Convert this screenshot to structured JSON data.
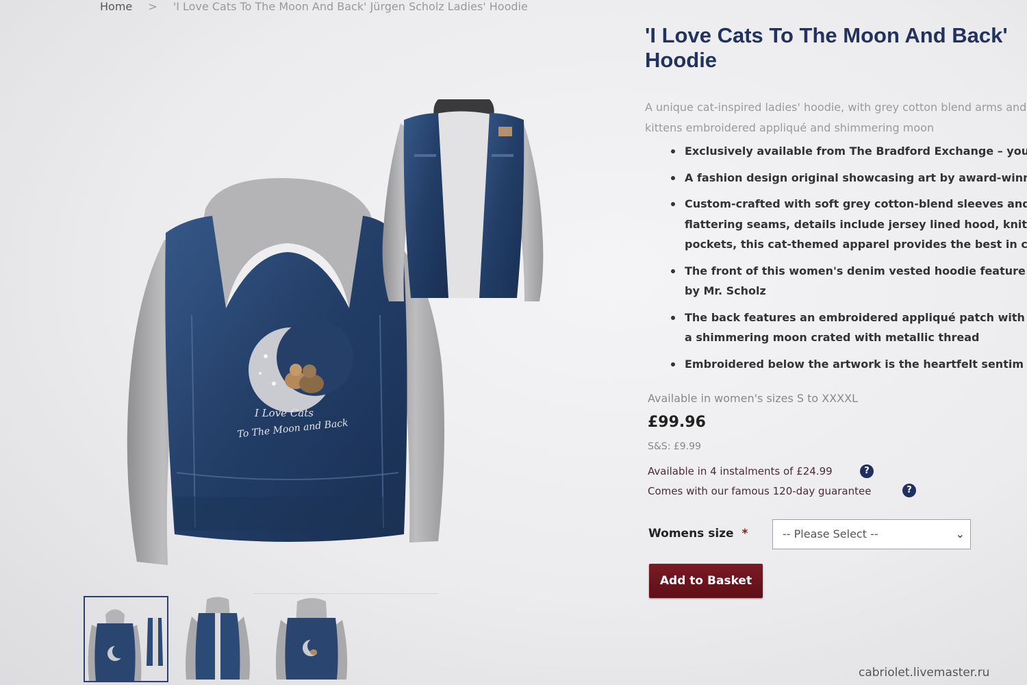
{
  "breadcrumb": {
    "home": "Home",
    "separator": ">",
    "current": "'I Love Cats To The Moon And Back' Jürgen Scholz Ladies' Hoodie"
  },
  "product": {
    "title_line1": "'I Love Cats To The Moon And Back'",
    "title_line2": "Hoodie",
    "description_line1": "A unique cat-inspired ladies' hoodie, with grey cotton blend arms and",
    "description_line2": "kittens embroidered appliqué and shimmering moon",
    "bullets": [
      {
        "lines": [
          "Exclusively available from The Bradford Exchange – you"
        ]
      },
      {
        "lines": [
          "A fashion design original showcasing art by award-winn"
        ]
      },
      {
        "lines": [
          "Custom-crafted with soft grey cotton-blend sleeves and",
          "flattering seams, details include jersey lined hood, knit",
          "pockets, this cat-themed apparel provides the best in co"
        ]
      },
      {
        "lines": [
          "The front of this women's denim vested hoodie feature",
          "by Mr. Scholz"
        ]
      },
      {
        "lines": [
          "The back features an embroidered appliqué patch with",
          "a shimmering moon crated with metallic thread"
        ]
      },
      {
        "lines": [
          "Embroidered below the artwork is the heartfelt sentim"
        ]
      }
    ],
    "embroidery_line1": "I Love Cats",
    "embroidery_line2": "To The Moon and Back",
    "sizes_note": "Available in women's sizes S to XXXXL",
    "price": "£99.96",
    "shipping": "S&S: £9.99",
    "instalments": "Available in 4 instalments of £24.99",
    "guarantee": "Comes with our famous 120-day guarantee",
    "help_glyph": "?"
  },
  "size_select": {
    "label": "Womens size",
    "required_mark": "*",
    "selected": "-- Please Select --"
  },
  "add_to_basket_label": "Add to Basket",
  "watermark": "cabriolet.livemaster.ru",
  "colors": {
    "title": "#22325f",
    "button": "#6b1420",
    "denim": "#2c4a75",
    "sleeve": "#a9a9ab"
  }
}
